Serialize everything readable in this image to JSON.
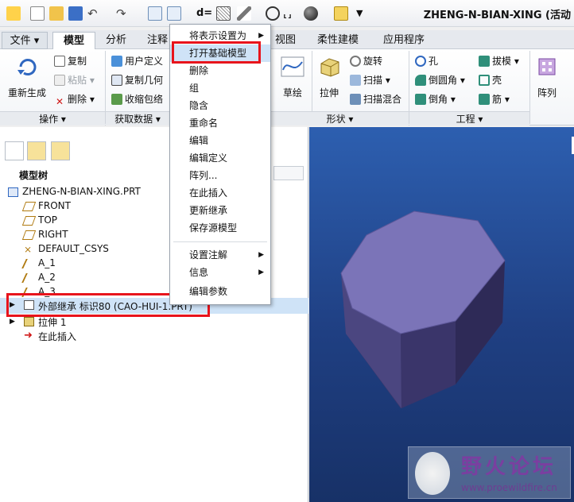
{
  "window": {
    "title": "ZHENG-N-BIAN-XING (活动"
  },
  "tabs": [
    {
      "label": "文件 ▾"
    },
    {
      "label": "模型"
    },
    {
      "label": "分析"
    },
    {
      "label": "注释"
    },
    {
      "label": "视图"
    },
    {
      "label": "柔性建模"
    },
    {
      "label": "应用程序"
    }
  ],
  "ribbon": {
    "regenerate": "重新生成",
    "copy": "复制",
    "paste": "粘贴",
    "delete": "删除",
    "user_defined": "用户定义",
    "copy_geometry": "复制几何",
    "shrinkwrap": "收缩包络",
    "sketch": "草绘",
    "extrude": "拉伸",
    "revolve": "旋转",
    "sweep": "扫描",
    "swept_blend": "扫描混合",
    "hole": "孔",
    "round": "倒圆角",
    "chamfer": "倒角",
    "draft": "拔模",
    "shell": "壳",
    "rib": "筋",
    "pattern": "阵列",
    "groups": {
      "operations": "操作 ▾",
      "get_data": "获取数据 ▾",
      "shapes": "形状 ▾",
      "engineering": "工程 ▾"
    }
  },
  "model_tree": {
    "header": "模型树",
    "root": "ZHENG-N-BIAN-XING.PRT",
    "items": [
      {
        "label": "FRONT"
      },
      {
        "label": "TOP"
      },
      {
        "label": "RIGHT"
      },
      {
        "label": "DEFAULT_CSYS"
      },
      {
        "label": "A_1"
      },
      {
        "label": "A_2"
      },
      {
        "label": "A_3"
      },
      {
        "label": "外部继承 标识80 (CAO-HUI-1.PRT)"
      },
      {
        "label": "拉伸 1"
      },
      {
        "label": "在此插入"
      }
    ]
  },
  "context_menu": {
    "items": [
      {
        "label": "将表示设置为"
      },
      {
        "label": "打开基础模型"
      },
      {
        "label": "删除"
      },
      {
        "label": "组"
      },
      {
        "label": "隐含"
      },
      {
        "label": "重命名"
      },
      {
        "label": "编辑"
      },
      {
        "label": "编辑定义"
      },
      {
        "label": "阵列..."
      },
      {
        "label": "在此插入"
      },
      {
        "label": "更新继承"
      },
      {
        "label": "保存源模型"
      },
      {
        "label": "设置注解"
      },
      {
        "label": "信息"
      },
      {
        "label": "编辑参数"
      }
    ]
  },
  "watermark": {
    "title": "野火论坛",
    "url": "www.proewildfire.cn"
  },
  "colors": {
    "highlight": "#e8141c",
    "selection": "#cfe3f7",
    "model_top": "#7b74b8",
    "model_side": "#3f3a6e",
    "viewport": "#2d5fb0"
  }
}
